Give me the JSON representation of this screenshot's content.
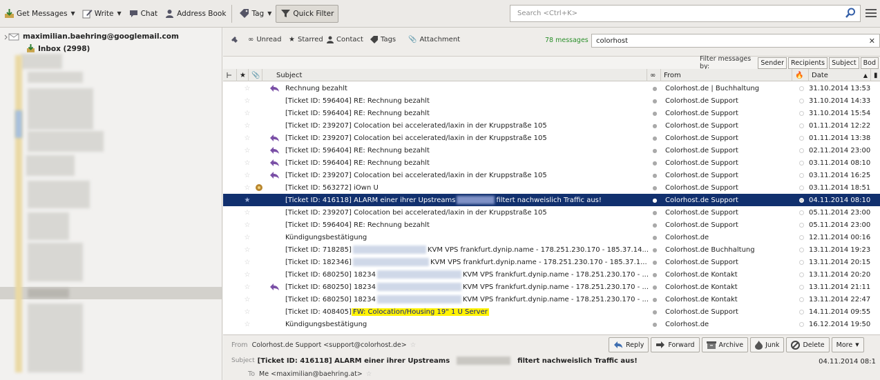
{
  "toolbar": {
    "get_messages": "Get Messages",
    "write": "Write",
    "chat": "Chat",
    "address_book": "Address Book",
    "tag": "Tag",
    "quick_filter": "Quick Filter",
    "search_placeholder": "Search <Ctrl+K>"
  },
  "folders": {
    "account": "maximilian.baehring@googlemail.com",
    "inbox": "Inbox (2998)"
  },
  "quickfilter": {
    "unread": "Unread",
    "starred": "Starred",
    "contact": "Contact",
    "tags": "Tags",
    "attachment": "Attachment",
    "message_count": "78 messages",
    "filter_text": "colorhost",
    "filter_by_label": "Filter messages by:",
    "sender": "Sender",
    "recipients": "Recipients",
    "subject": "Subject",
    "body": "Bod"
  },
  "columns": {
    "subject": "Subject",
    "from": "From",
    "date": "Date"
  },
  "messages": [
    {
      "subject": "Rechnung bezahlt",
      "from": "Colorhost.de | Buchhaltung",
      "date": "31.10.2014 13:53",
      "replied": true
    },
    {
      "subject": "[Ticket ID: 596404] RE: Rechnung bezahlt",
      "from": "Colorhost.de Support",
      "date": "31.10.2014 14:33"
    },
    {
      "subject": "[Ticket ID: 596404] RE: Rechnung bezahlt",
      "from": "Colorhost.de Support",
      "date": "31.10.2014 15:54"
    },
    {
      "subject": "[Ticket ID: 239207] Colocation bei accelerated/laxin in der Kruppstraße 105",
      "from": "Colorhost.de Support",
      "date": "01.11.2014 12:22"
    },
    {
      "subject": "[Ticket ID: 239207] Colocation bei accelerated/laxin in der Kruppstraße 105",
      "from": "Colorhost.de Support",
      "date": "01.11.2014 13:38",
      "replied": true
    },
    {
      "subject": "[Ticket ID: 596404] RE: Rechnung bezahlt",
      "from": "Colorhost.de Support",
      "date": "02.11.2014 23:00",
      "replied": true
    },
    {
      "subject": "[Ticket ID: 596404] RE: Rechnung bezahlt",
      "from": "Colorhost.de Support",
      "date": "03.11.2014 08:10",
      "replied": true
    },
    {
      "subject": "[Ticket ID: 239207] Colocation bei accelerated/laxin in der Kruppstraße 105",
      "from": "Colorhost.de Support",
      "date": "03.11.2014 16:25",
      "replied": true
    },
    {
      "subject": "[Ticket ID: 563272] iOwn U",
      "from": "Colorhost.de Support",
      "date": "03.11.2014 18:51",
      "attachment": true
    },
    {
      "subject_a": "[Ticket ID: 416118] ALARM einer ihrer Upstreams",
      "subject_b": "filtert nachweislich Traffic aus!",
      "from": "Colorhost.de Support",
      "date": "04.11.2014 08:10",
      "selected": true
    },
    {
      "subject": "[Ticket ID: 239207] Colocation bei accelerated/laxin in der Kruppstraße 105",
      "from": "Colorhost.de Support",
      "date": "05.11.2014 23:00"
    },
    {
      "subject": "[Ticket ID: 596404] RE: Rechnung bezahlt",
      "from": "Colorhost.de Support",
      "date": "05.11.2014 23:00"
    },
    {
      "subject": "Kündigungsbestätigung",
      "from": "Colorhost.de",
      "date": "12.11.2014 00:16"
    },
    {
      "subject_a": "[Ticket ID: 718285]",
      "subject_b": "KVM VPS frankfurt.dynip.name - 178.251.230.170 - 185.37.14...",
      "from": "Colorhost.de Buchhaltung",
      "date": "13.11.2014 19:23"
    },
    {
      "subject_a": "[Ticket ID: 182346]",
      "subject_b": "KVM VPS frankfurt.dynip.name - 178.251.230.170 - 185.37.1...",
      "from": "Colorhost.de Support",
      "date": "13.11.2014 20:15"
    },
    {
      "subject_a": "[Ticket ID: 680250] 18234",
      "subject_b": "KVM VPS frankfurt.dynip.name - 178.251.230.170 - ...",
      "from": "Colorhost.de Kontakt",
      "date": "13.11.2014 20:20"
    },
    {
      "subject_a": "[Ticket ID: 680250] 18234",
      "subject_b": "KVM VPS frankfurt.dynip.name - 178.251.230.170 - ...",
      "from": "Colorhost.de Kontakt",
      "date": "13.11.2014 21:11",
      "replied": true
    },
    {
      "subject_a": "[Ticket ID: 680250] 18234",
      "subject_b": "KVM VPS frankfurt.dynip.name - 178.251.230.170 - ...",
      "from": "Colorhost.de Kontakt",
      "date": "13.11.2014 22:47"
    },
    {
      "subject_a": "[Ticket ID: 408405]",
      "subject_hl": "FW: Colocation/Housing 19\" 1 U Server",
      "from": "Colorhost.de Support",
      "date": "14.11.2014 09:55"
    },
    {
      "subject": "Kündigungsbestätigung",
      "from": "Colorhost.de",
      "date": "16.12.2014 19:50"
    }
  ],
  "header": {
    "from_label": "From",
    "from_value": "Colorhost.de Support <support@colorhost.de>",
    "reply": "Reply",
    "forward": "Forward",
    "archive": "Archive",
    "junk": "Junk",
    "delete": "Delete",
    "more": "More",
    "subject_label": "Subject",
    "subject_a": "[Ticket ID: 416118] ALARM einer ihrer Upstreams",
    "subject_b": "filtert nachweislich Traffic aus!",
    "date": "04.11.2014 08:1",
    "to_label": "To",
    "to_value": "Me <maximilian@baehring.at>"
  },
  "colors": {
    "selection": "#11306e",
    "highlight": "#fff200",
    "message_count": "#2a8f2a",
    "reply_arrow": "#7a4fa6"
  }
}
